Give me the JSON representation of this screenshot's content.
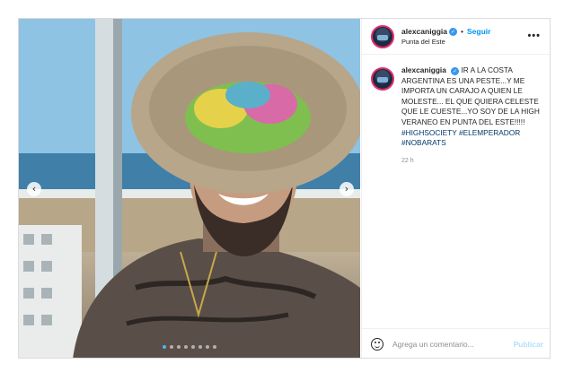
{
  "post": {
    "slide_count": 8,
    "active_slide": 1,
    "prev_icon": "chevron-left-icon",
    "next_icon": "chevron-right-icon"
  },
  "header": {
    "username": "alexcaniggia",
    "separator": "•",
    "follow_label": "Seguir",
    "location": "Punta del Este",
    "more_label": "•••"
  },
  "caption": {
    "username": "alexcaniggia",
    "text": "IR A LA COSTA ARGENTINA ES UNA PESTE...Y ME IMPORTA UN CARAJO A QUIEN LE MOLESTE... EL QUE QUIERA CELESTE QUE LE CUESTE...YO SOY DE LA HIGH VERANEO EN PUNTA DEL ESTE!!!!!",
    "hashtags": [
      "#HIGHSOCIETY",
      "#ELEMPERADOR",
      "#NOBARATS"
    ],
    "time": "22 h"
  },
  "comment_bar": {
    "placeholder": "Agrega un comentario...",
    "publish_label": "Publicar"
  },
  "colors": {
    "follow": "#0095f6",
    "verified": "#3897f0",
    "hashtag": "#00376b",
    "publish_disabled": "#b2dffc"
  }
}
